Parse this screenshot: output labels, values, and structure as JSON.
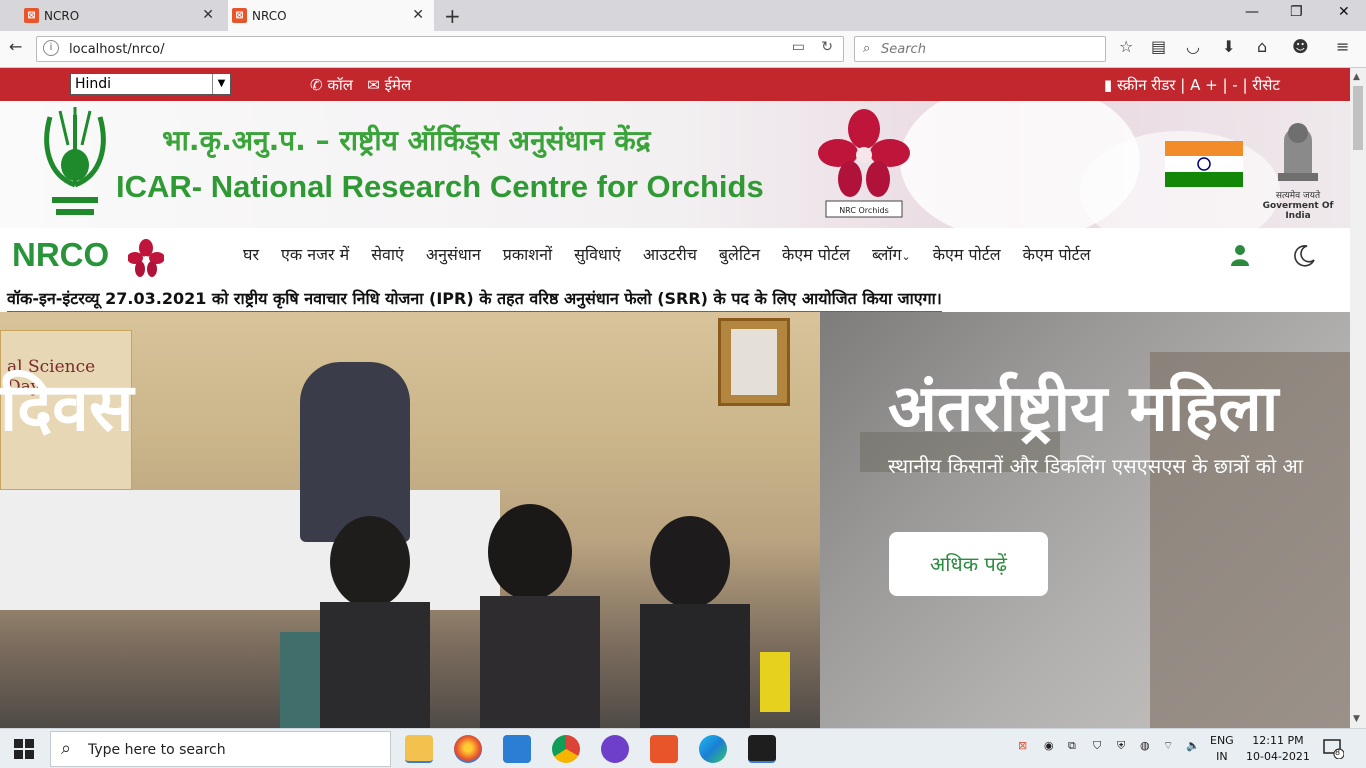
{
  "browser": {
    "tabs": [
      {
        "title": "NCRO",
        "active": false
      },
      {
        "title": "NRCO",
        "active": true
      }
    ],
    "url": "localhost/nrco/",
    "search_placeholder": "Search"
  },
  "topbar": {
    "language": "Hindi",
    "call": "कॉल",
    "email": "ईमेल",
    "screen_reader": "स्क्रीन रीडर",
    "font_tools": "| A + | - | रीसेट"
  },
  "header": {
    "title_hindi": "भा.कृ.अनु.प. – राष्ट्रीय ऑर्किड्स अनुसंधान केंद्र",
    "title_english": "ICAR- National Research Centre for Orchids",
    "orchid_logo_text": "NRC Orchids",
    "emblem_caption_hindi": "सत्यमेव जयते",
    "emblem_caption": "Goverment Of India"
  },
  "nav": {
    "brand": "NRCO",
    "items": [
      "घर",
      "एक नजर में",
      "सेवाएं",
      "अनुसंधान",
      "प्रकाशनों",
      "सुविधाएं",
      "आउटरीच",
      "बुलेटिन",
      "केएम पोर्टल",
      "ब्लॉग",
      "केएम पोर्टल",
      "केएम पोर्टल"
    ]
  },
  "ticker": {
    "text": "वॉक-इन-इंटरव्यू 27.03.2021 को राष्ट्रीय कृषि नवाचार निधि योजना (IPR) के तहत वरिष्ठ अनुसंधान फेलो (SRR) के पद के लिए आयोजित किया जाएगा।"
  },
  "hero": {
    "left_heading": "दिवस",
    "right_heading": "अंतर्राष्ट्रीय महिला",
    "right_sub": "स्थानीय किसानों और डिकलिंग एसएसएस के छात्रों को आ",
    "read_more": "अधिक पढ़ें",
    "banner_sign": "al Science Day"
  },
  "taskbar": {
    "search_placeholder": "Type here to search",
    "lang_top": "ENG",
    "lang_bottom": "IN",
    "time": "12:11 PM",
    "date": "10-04-2021",
    "notifications": "8"
  },
  "colors": {
    "accent_red": "#c1272d",
    "brand_green": "#2f9a34"
  }
}
